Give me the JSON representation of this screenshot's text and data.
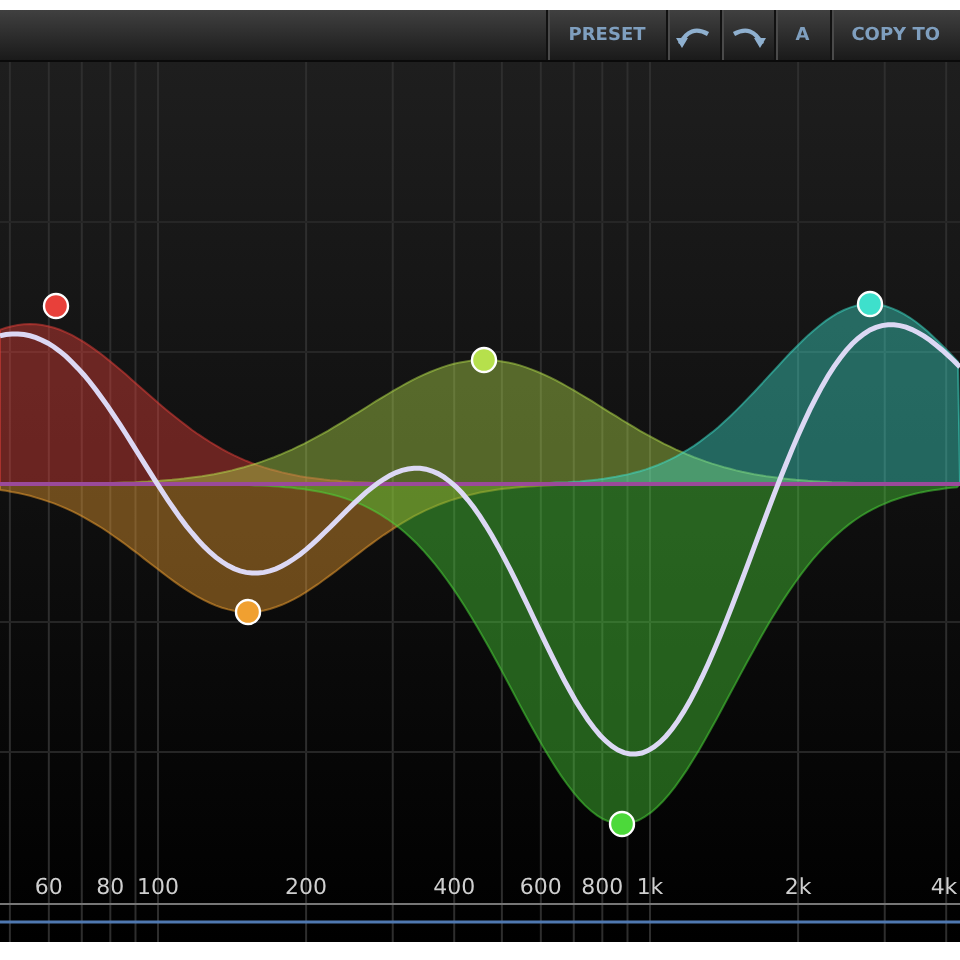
{
  "toolbar": {
    "buttons": [
      {
        "kind": "text",
        "label": "PRESET"
      },
      {
        "kind": "undo"
      },
      {
        "kind": "redo"
      },
      {
        "kind": "text",
        "label": "A"
      },
      {
        "kind": "text",
        "label": "COPY TO"
      }
    ]
  },
  "bands": [
    {
      "color": "#e8403a"
    },
    {
      "color": "#f0a030"
    },
    {
      "color": "#b6e04c"
    },
    {
      "color": "#4cd93a"
    },
    {
      "color": "#3ee0cc"
    }
  ],
  "frequency_labels": [
    "60",
    "80",
    "100",
    "200",
    "400",
    "600",
    "800",
    "1k",
    "2k",
    "4k"
  ]
}
